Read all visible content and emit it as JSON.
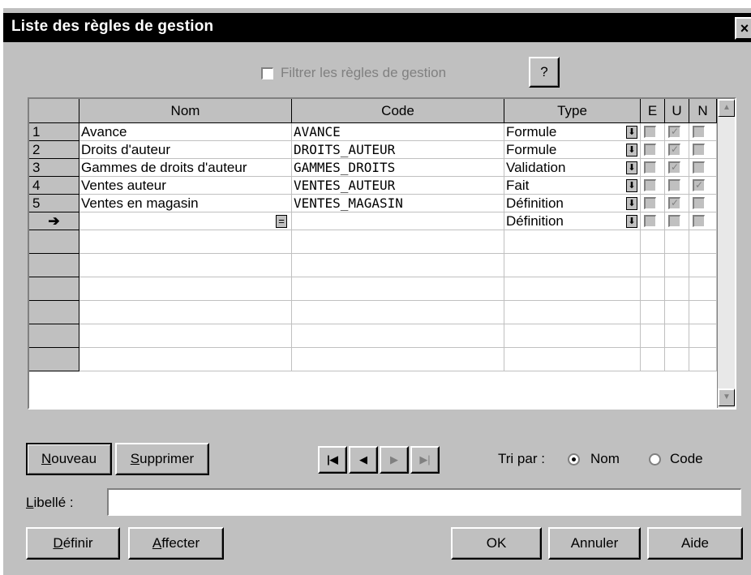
{
  "window": {
    "title": "Liste des règles de gestion",
    "close_label": "×"
  },
  "filter": {
    "label": "Filtrer les règles de gestion",
    "checked": false,
    "help_label": "?"
  },
  "grid": {
    "columns": [
      "Nom",
      "Code",
      "Type",
      "E",
      "U",
      "N"
    ],
    "rows": [
      {
        "num": "1",
        "nom": "Avance",
        "code": "AVANCE",
        "type": "Formule",
        "e": false,
        "u": true,
        "n": false
      },
      {
        "num": "2",
        "nom": "Droits d'auteur",
        "code": "DROITS_AUTEUR",
        "type": "Formule",
        "e": false,
        "u": true,
        "n": false
      },
      {
        "num": "3",
        "nom": "Gammes de droits d'auteur",
        "code": "GAMMES_DROITS",
        "type": "Validation",
        "e": false,
        "u": true,
        "n": false
      },
      {
        "num": "4",
        "nom": "Ventes auteur",
        "code": "VENTES_AUTEUR",
        "type": "Fait",
        "e": false,
        "u": false,
        "n": true
      },
      {
        "num": "5",
        "nom": "Ventes en magasin",
        "code": "VENTES_MAGASIN",
        "type": "Définition",
        "e": false,
        "u": true,
        "n": false
      }
    ],
    "new_row": {
      "marker": "➔",
      "equals_label": "=",
      "type": "Définition"
    },
    "empty_rows": 6,
    "dropdown_glyph": "⬇"
  },
  "buttons": {
    "nouveau": "Nouveau",
    "supprimer": "Supprimer",
    "definir": "Définir",
    "affecter": "Affecter",
    "ok": "OK",
    "annuler": "Annuler",
    "aide": "Aide"
  },
  "nav": {
    "first": "|◀",
    "prev": "◀",
    "next": "▶",
    "last": "▶|"
  },
  "sort": {
    "label": "Tri par :",
    "options": [
      {
        "label": "Nom",
        "selected": true
      },
      {
        "label": "Code",
        "selected": false
      }
    ]
  },
  "libelle": {
    "label": "Libellé :",
    "value": ""
  },
  "colors": {
    "face": "#c0c0c0",
    "title_bg": "#000000",
    "disabled_text": "#808080"
  }
}
